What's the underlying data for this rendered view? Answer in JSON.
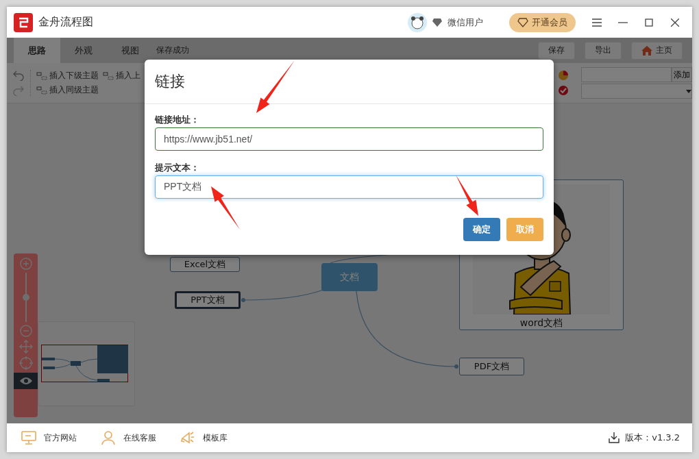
{
  "window": {
    "title": "金舟流程图"
  },
  "user": {
    "name": "微信用户"
  },
  "vip_button": "开通会员",
  "tabs": [
    {
      "label": "思路",
      "selected": true
    },
    {
      "label": "外观",
      "selected": false
    },
    {
      "label": "视图",
      "selected": false
    }
  ],
  "save_status": "保存成功",
  "actions": [
    "保存",
    "导出",
    "主页"
  ],
  "toolbar": {
    "items": [
      "插入下级主题",
      "插入上",
      "插入同级主题"
    ],
    "add_button": "添加"
  },
  "canvas": {
    "nodes": [
      {
        "kind": "plain",
        "label": "Excel文档",
        "selected": false
      },
      {
        "kind": "plain",
        "label": "PPT文档",
        "selected": true
      },
      {
        "kind": "root",
        "label": "文档",
        "selected": false
      },
      {
        "label": "word文档",
        "selected": false
      },
      {
        "kind": "plain",
        "label": "PDF文档",
        "selected": false
      }
    ]
  },
  "zoom": {
    "level": 0.5
  },
  "dialog": {
    "title": "链接",
    "fields": [
      {
        "label": "链接地址：",
        "value": "https://www.jb51.net/",
        "focused": false
      },
      {
        "label": "提示文本：",
        "value": "PPT文档",
        "focused": true
      }
    ],
    "buttons": [
      {
        "label": "确定",
        "kind": "primary"
      },
      {
        "label": "取消",
        "kind": "warning"
      }
    ]
  },
  "footer": {
    "links": [
      {
        "label": "官方网站",
        "kind": "monitor"
      },
      {
        "label": "在线客服",
        "kind": "person"
      },
      {
        "label": "模板库",
        "kind": "megaphone"
      }
    ],
    "version": "版本：v1.3.2"
  }
}
